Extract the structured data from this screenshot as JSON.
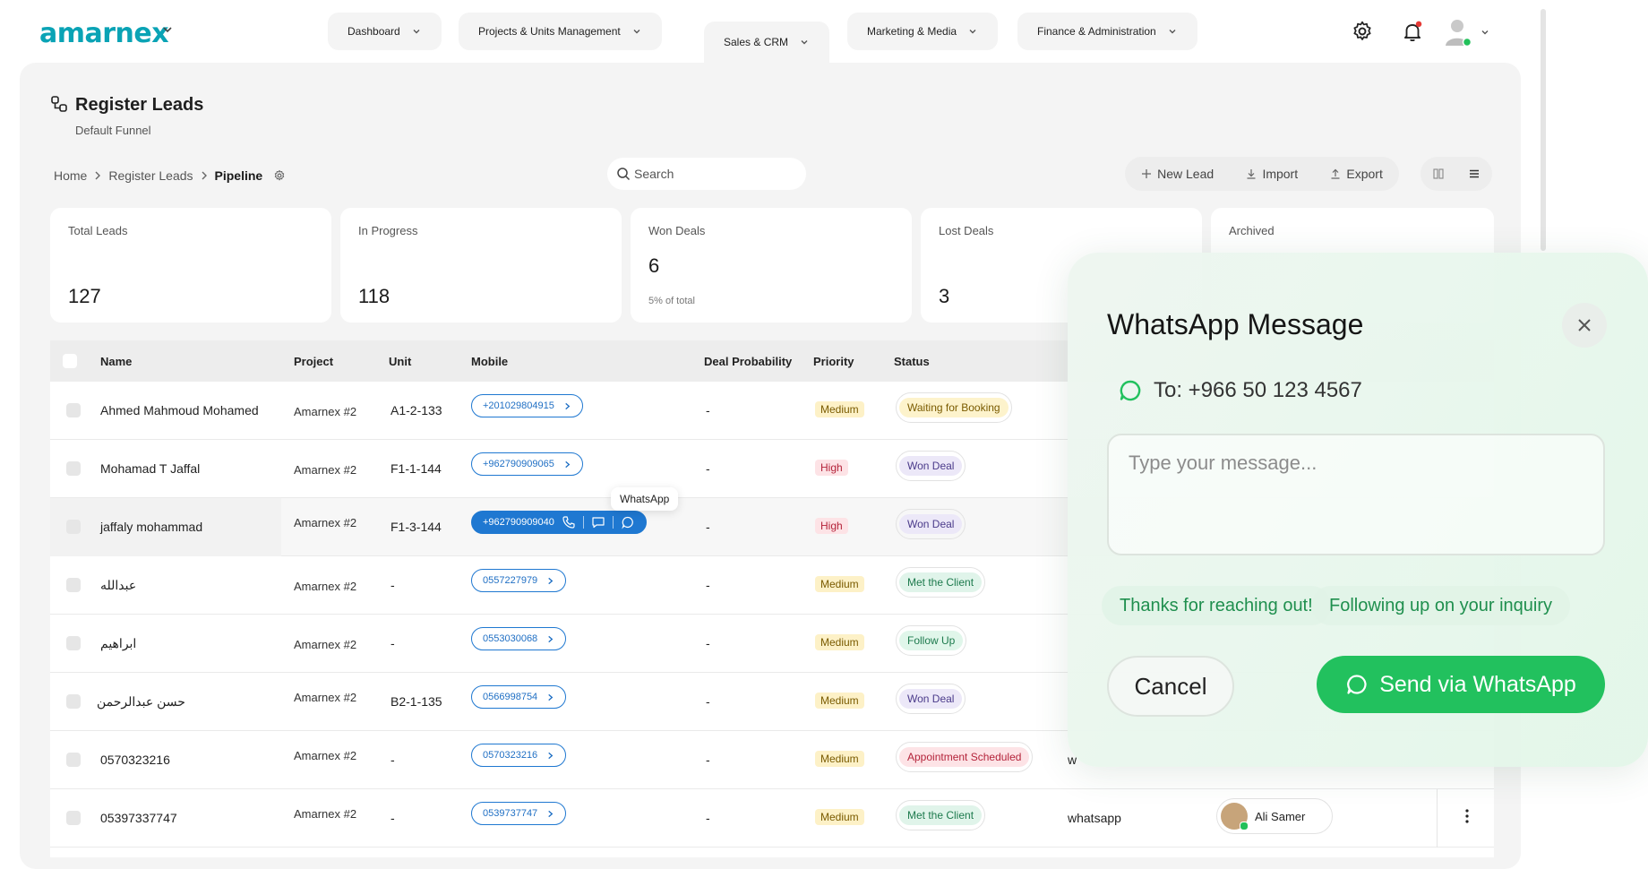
{
  "brand": {
    "name": "amarnex"
  },
  "nav": {
    "items": [
      {
        "label": "Dashboard"
      },
      {
        "label": "Projects & Units Management"
      },
      {
        "label": "Sales & CRM"
      },
      {
        "label": "Marketing & Media"
      },
      {
        "label": "Finance & Administration"
      }
    ],
    "active": "Sales & CRM"
  },
  "page": {
    "title": "Register Leads",
    "subtitle": "Default Funnel"
  },
  "breadcrumb": [
    "Home",
    "Register Leads",
    "Pipeline"
  ],
  "search": {
    "placeholder": "Search"
  },
  "actions": {
    "new_lead": "New Lead",
    "import": "Import",
    "export": "Export"
  },
  "stats": [
    {
      "label": "Total Leads",
      "value": "127"
    },
    {
      "label": "In Progress",
      "value": "118"
    },
    {
      "label": "Won Deals",
      "value": "6",
      "sub": "5% of total"
    },
    {
      "label": "Lost Deals",
      "value": "3"
    },
    {
      "label": "Archived"
    }
  ],
  "table": {
    "columns": [
      "Name",
      "Project",
      "Unit",
      "Mobile",
      "Deal Probability",
      "Priority",
      "Status"
    ],
    "rows": [
      {
        "name": "Ahmed Mahmoud Mohamed",
        "project": "Amarnex #2",
        "unit": "A1-2-133",
        "mobile": "+201029804915",
        "prob": "-",
        "priority": "Medium",
        "status": "Waiting for Booking"
      },
      {
        "name": "Mohamad T Jaffal",
        "project": "Amarnex #2",
        "unit": "F1-1-144",
        "mobile": "+962790909065",
        "prob": "-",
        "priority": "High",
        "status": "Won Deal"
      },
      {
        "name": "jaffaly mohammad",
        "project": "Amarnex #2",
        "unit": "F1-3-144",
        "mobile": "+962790909040",
        "prob": "-",
        "priority": "High",
        "status": "Won Deal"
      },
      {
        "name": "عبدالله",
        "project": "Amarnex #2",
        "unit": "-",
        "mobile": "0557227979",
        "prob": "-",
        "priority": "Medium",
        "status": "Met the Client"
      },
      {
        "name": "ابراهيم",
        "project": "Amarnex #2",
        "unit": "-",
        "mobile": "0553030068",
        "prob": "-",
        "priority": "Medium",
        "status": "Follow Up"
      },
      {
        "name": "حسن عبدالرحمن",
        "project": "Amarnex #2",
        "unit": "B2-1-135",
        "mobile": "0566998754",
        "prob": "-",
        "priority": "Medium",
        "status": "Won Deal"
      },
      {
        "name": "0570323216",
        "project": "Amarnex #2",
        "unit": "-",
        "mobile": "0570323216",
        "prob": "-",
        "priority": "Medium",
        "status": "Appointment Scheduled",
        "source": "w"
      },
      {
        "name": "05397337747",
        "project": "Amarnex #2",
        "unit": "-",
        "mobile": "0539737747",
        "prob": "-",
        "priority": "Medium",
        "status": "Met the Client",
        "source": "whatsapp",
        "agent": "Ali Samer"
      }
    ]
  },
  "tooltip": "WhatsApp",
  "modal": {
    "title": "WhatsApp Message",
    "to": "To: +966 50 123 4567",
    "placeholder": "Type your message...",
    "chips": [
      "Thanks for reaching out!",
      "Following up on your inquiry"
    ],
    "cancel": "Cancel",
    "send": "Send via WhatsApp"
  },
  "colors": {
    "brand": "#0aa3b5",
    "whatsapp": "#22c15e",
    "phone_accent": "#1f78d1"
  }
}
